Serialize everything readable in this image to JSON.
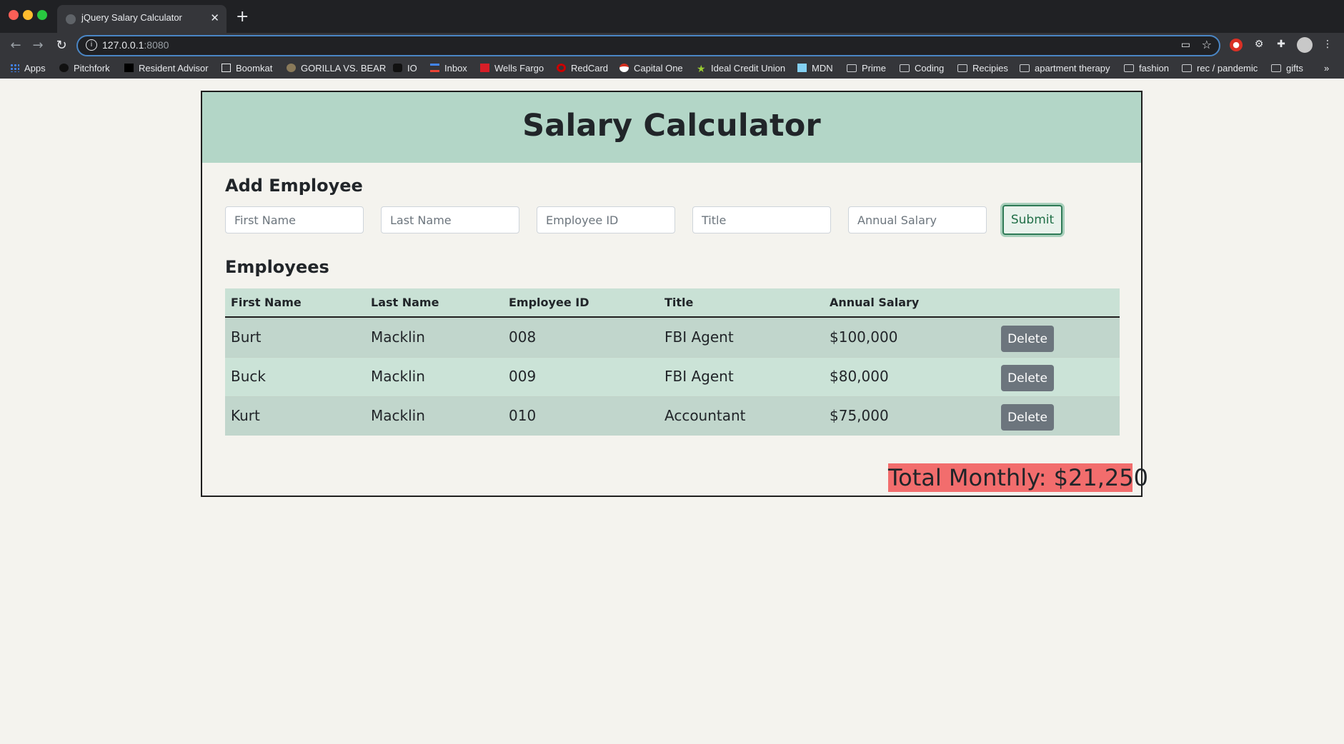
{
  "browser": {
    "tab_title": "jQuery Salary Calculator",
    "url_host": "127.0.0.1",
    "url_port": ":8080",
    "info_glyph": "i",
    "bookmarks": [
      {
        "label": "Apps",
        "icon": "apps-grid-icon"
      },
      {
        "label": "Pitchfork",
        "icon": "pitchfork-icon"
      },
      {
        "label": "Resident Advisor",
        "icon": "resident-advisor-icon"
      },
      {
        "label": "Boomkat",
        "icon": "boomkat-icon"
      },
      {
        "label": "GORILLA VS. BEAR",
        "icon": "gorilla-vs-bear-icon"
      },
      {
        "label": "IO",
        "icon": "io-icon"
      },
      {
        "label": "Inbox",
        "icon": "gmail-icon"
      },
      {
        "label": "Wells Fargo",
        "icon": "wells-fargo-icon"
      },
      {
        "label": "RedCard",
        "icon": "target-icon"
      },
      {
        "label": "Capital One",
        "icon": "capital-one-icon"
      },
      {
        "label": "Ideal Credit Union",
        "icon": "star-icon"
      },
      {
        "label": "MDN",
        "icon": "mdn-icon"
      },
      {
        "label": "Prime",
        "icon": "folder-icon"
      },
      {
        "label": "Coding",
        "icon": "folder-icon"
      },
      {
        "label": "Recipies",
        "icon": "folder-icon"
      },
      {
        "label": "apartment therapy",
        "icon": "folder-icon"
      },
      {
        "label": "fashion",
        "icon": "folder-icon"
      },
      {
        "label": "rec / pandemic",
        "icon": "folder-icon"
      },
      {
        "label": "gifts",
        "icon": "folder-icon"
      }
    ],
    "overflow_label": "»"
  },
  "app": {
    "title": "Salary Calculator",
    "add_heading": "Add Employee",
    "employees_heading": "Employees",
    "form": {
      "first_name_placeholder": "First Name",
      "last_name_placeholder": "Last Name",
      "employee_id_placeholder": "Employee ID",
      "title_placeholder": "Title",
      "annual_salary_placeholder": "Annual Salary",
      "submit_label": "Submit"
    },
    "table": {
      "headers": [
        "First Name",
        "Last Name",
        "Employee ID",
        "Title",
        "Annual Salary"
      ],
      "rows": [
        {
          "first": "Burt",
          "last": "Macklin",
          "id": "008",
          "title": "FBI Agent",
          "salary": "$100,000",
          "action": "Delete"
        },
        {
          "first": "Buck",
          "last": "Macklin",
          "id": "009",
          "title": "FBI Agent",
          "salary": "$80,000",
          "action": "Delete"
        },
        {
          "first": "Kurt",
          "last": "Macklin",
          "id": "010",
          "title": "Accountant",
          "salary": "$75,000",
          "action": "Delete"
        }
      ]
    },
    "total_monthly": "Total Monthly: $21,250",
    "colors": {
      "header_bg": "#b3d6c7",
      "total_bg": "#f26d6d",
      "delete_bg": "#6c757d",
      "submit_border": "#2f7a56"
    }
  }
}
